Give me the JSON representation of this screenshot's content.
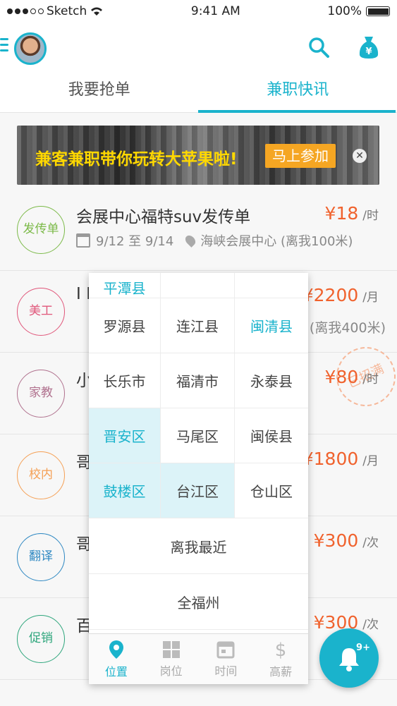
{
  "status": {
    "carrier": "Sketch",
    "time": "9:41 AM",
    "battery": "100%"
  },
  "tabs": [
    {
      "label": "我要抢单",
      "active": false
    },
    {
      "label": "兼职快讯",
      "active": true
    }
  ],
  "banner": {
    "text": "兼客兼职带你玩转大苹果啦!",
    "button": "马上参加"
  },
  "jobs": [
    {
      "cat": "发传单",
      "catColor": "#7cba49",
      "title": "会展中心福特suv发传单",
      "date": "9/12 至 9/14",
      "location": "海峡会展中心 (离我100米)",
      "price": "¥18",
      "unit": "/时"
    },
    {
      "cat": "美工",
      "catColor": "#e0567a",
      "title": "I I",
      "price": "¥2200",
      "unit": "/月",
      "sub": ") (离我400米)"
    },
    {
      "cat": "家教",
      "catColor": "#b0718e",
      "title": "小",
      "price": "¥80",
      "unit": "/时",
      "stamp": "已招满"
    },
    {
      "cat": "校内",
      "catColor": "#f5a055",
      "title": "哥",
      "price": "¥1800",
      "unit": "/月"
    },
    {
      "cat": "翻译",
      "catColor": "#2e88c2",
      "title": "哥",
      "price": "¥300",
      "unit": "/次"
    },
    {
      "cat": "促销",
      "catColor": "#2ea67c",
      "title": "百",
      "price": "¥300",
      "unit": "/次"
    }
  ],
  "popup": {
    "top_row": [
      "平潭县",
      "",
      ""
    ],
    "grid": [
      [
        "罗源县",
        "连江县",
        "闽清县"
      ],
      [
        "长乐市",
        "福清市",
        "永泰县"
      ],
      [
        "晋安区",
        "马尾区",
        "闽侯县"
      ],
      [
        "鼓楼区",
        "台江区",
        "仓山区"
      ]
    ],
    "nearest": "离我最近",
    "all": "全福州",
    "tabs": [
      "位置",
      "岗位",
      "时间",
      "高薪"
    ]
  },
  "fab": {
    "badge": "9+"
  },
  "colors": {
    "accent": "#1ab3cc",
    "price": "#f0622d"
  }
}
